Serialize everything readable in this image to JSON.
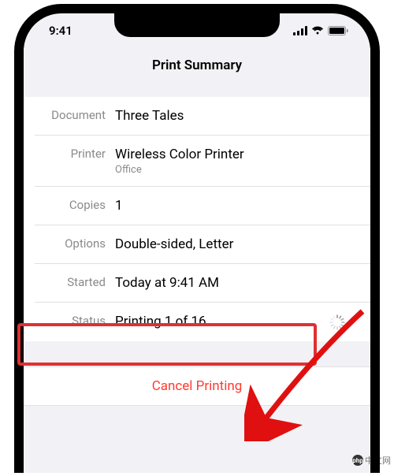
{
  "status_bar": {
    "time": "9:41"
  },
  "header": {
    "title": "Print Summary"
  },
  "rows": {
    "document": {
      "label": "Document",
      "value": "Three Tales"
    },
    "printer": {
      "label": "Printer",
      "value": "Wireless Color Printer",
      "subvalue": "Office"
    },
    "copies": {
      "label": "Copies",
      "value": "1"
    },
    "options": {
      "label": "Options",
      "value": "Double-sided, Letter"
    },
    "started": {
      "label": "Started",
      "value": "Today at 9:41 AM"
    },
    "status": {
      "label": "Status",
      "value": "Printing 1 of 16..."
    }
  },
  "actions": {
    "cancel": "Cancel Printing"
  },
  "watermark": {
    "text": "中文网"
  }
}
